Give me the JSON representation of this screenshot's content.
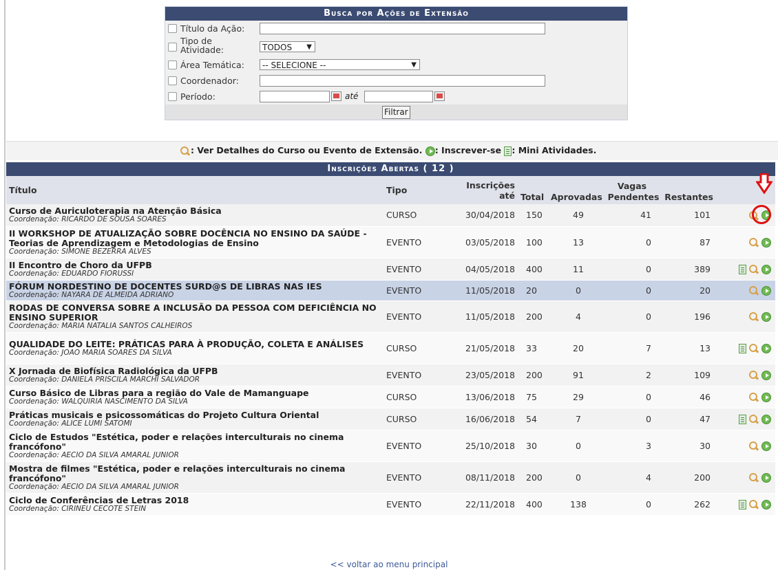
{
  "search": {
    "title": "Busca por Ações de Extensão",
    "fields": {
      "titulo": {
        "label": "Título da Ação:",
        "value": ""
      },
      "tipo": {
        "label_line1": "Tipo de",
        "label_line2": "Atividade:",
        "value": "TODOS"
      },
      "area": {
        "label": "Área Temática:",
        "value": "-- SELECIONE --"
      },
      "coordenador": {
        "label": "Coordenador:",
        "value": ""
      },
      "periodo": {
        "label": "Período:",
        "ate": "até",
        "from": "",
        "to": ""
      }
    },
    "button": "Filtrar"
  },
  "legend": {
    "ver": ": Ver Detalhes do Curso ou Evento de Extensão.",
    "inscrever": ": Inscrever-se",
    "mini": ": Mini Atividades."
  },
  "table": {
    "title": "Inscrições Abertas ( 12 )",
    "headers": {
      "titulo": "Título",
      "tipo": "Tipo",
      "inscricoes1": "Inscrições",
      "inscricoes2": "até",
      "vagas": "Vagas",
      "total": "Total",
      "aprovadas": "Aprovadas",
      "pendentes": "Pendentes",
      "restantes": "Restantes"
    },
    "rows": [
      {
        "title": "Curso de Auriculoterapia na Atenção Básica",
        "coord": "Coordenação: RICARDO DE SOUSA SOARES",
        "tipo": "CURSO",
        "ate": "30/04/2018",
        "total": "150",
        "aprovadas": "49",
        "pendentes": "41",
        "restantes": "101"
      },
      {
        "title": "II WORKSHOP DE ATUALIZAÇÃO SOBRE DOCÊNCIA NO ENSINO DA SAÚDE - Teorias de Aprendizagem e Metodologias de Ensino",
        "coord": "Coordenação: SIMONE BEZERRA ALVES",
        "tipo": "EVENTO",
        "ate": "03/05/2018",
        "total": "100",
        "aprovadas": "13",
        "pendentes": "0",
        "restantes": "87"
      },
      {
        "title": "II Encontro de Choro da UFPB",
        "coord": "Coordenação: EDUARDO FIORUSSI",
        "tipo": "EVENTO",
        "ate": "04/05/2018",
        "total": "400",
        "aprovadas": "11",
        "pendentes": "0",
        "restantes": "389"
      },
      {
        "title": "FÓRUM NORDESTINO DE DOCENTES SURD@S DE LIBRAS NAS IES",
        "coord": "Coordenação: NAYARA DE ALMEIDA ADRIANO",
        "tipo": "EVENTO",
        "ate": "11/05/2018",
        "total": "20",
        "aprovadas": "0",
        "pendentes": "0",
        "restantes": "20"
      },
      {
        "title": "RODAS DE CONVERSA SOBRE A INCLUSÃO DA PESSOA COM DEFICIÊNCIA NO ENSINO SUPERIOR",
        "coord": "Coordenação: MARIA NATALIA SANTOS CALHEIROS",
        "tipo": "EVENTO",
        "ate": "11/05/2018",
        "total": "200",
        "aprovadas": "4",
        "pendentes": "0",
        "restantes": "196"
      },
      {
        "title": "QUALIDADE DO LEITE: PRÁTICAS PARA À PRODUÇÃO, COLETA E ANÁLISES",
        "coord": "Coordenação: JOAO MARIA SOARES DA SILVA",
        "tipo": "CURSO",
        "ate": "21/05/2018",
        "total": "33",
        "aprovadas": "20",
        "pendentes": "7",
        "restantes": "13"
      },
      {
        "title": "X Jornada de Biofísica Radiológica da UFPB",
        "coord": "Coordenação: DANIELA PRISCILA MARCHI SALVADOR",
        "tipo": "EVENTO",
        "ate": "23/05/2018",
        "total": "200",
        "aprovadas": "91",
        "pendentes": "2",
        "restantes": "109"
      },
      {
        "title": "Curso Básico de Libras para a região do Vale de Mamanguape",
        "coord": "Coordenação: WALQUIRIA NASCIMENTO DA SILVA",
        "tipo": "CURSO",
        "ate": "13/06/2018",
        "total": "75",
        "aprovadas": "29",
        "pendentes": "0",
        "restantes": "46"
      },
      {
        "title": "Práticas musicais e psicossomáticas do Projeto Cultura Oriental",
        "coord": "Coordenação: ALICE LUMI SATOMI",
        "tipo": "CURSO",
        "ate": "16/06/2018",
        "total": "54",
        "aprovadas": "7",
        "pendentes": "0",
        "restantes": "47"
      },
      {
        "title": "Ciclo de Estudos \"Estética, poder e relações interculturais no cinema francófono\"",
        "coord": "Coordenação: AECIO DA SILVA AMARAL JUNIOR",
        "tipo": "EVENTO",
        "ate": "25/10/2018",
        "total": "30",
        "aprovadas": "0",
        "pendentes": "3",
        "restantes": "30"
      },
      {
        "title": "Mostra de filmes \"Estética, poder e relações interculturais no cinema francófono\"",
        "coord": "Coordenação: AECIO DA SILVA AMARAL JUNIOR",
        "tipo": "EVENTO",
        "ate": "08/11/2018",
        "total": "200",
        "aprovadas": "0",
        "pendentes": "4",
        "restantes": "200"
      },
      {
        "title": "Ciclo de Conferências de Letras 2018",
        "coord": "Coordenação: CIRINEU CECOTE STEIN",
        "tipo": "EVENTO",
        "ate": "22/11/2018",
        "total": "400",
        "aprovadas": "138",
        "pendentes": "0",
        "restantes": "262"
      }
    ]
  },
  "back_link": "<< voltar ao menu principal",
  "colors": {
    "header_bar": "#3b4b72",
    "highlight_row": "#c9d3e6",
    "annotation_red": "#e01010"
  }
}
